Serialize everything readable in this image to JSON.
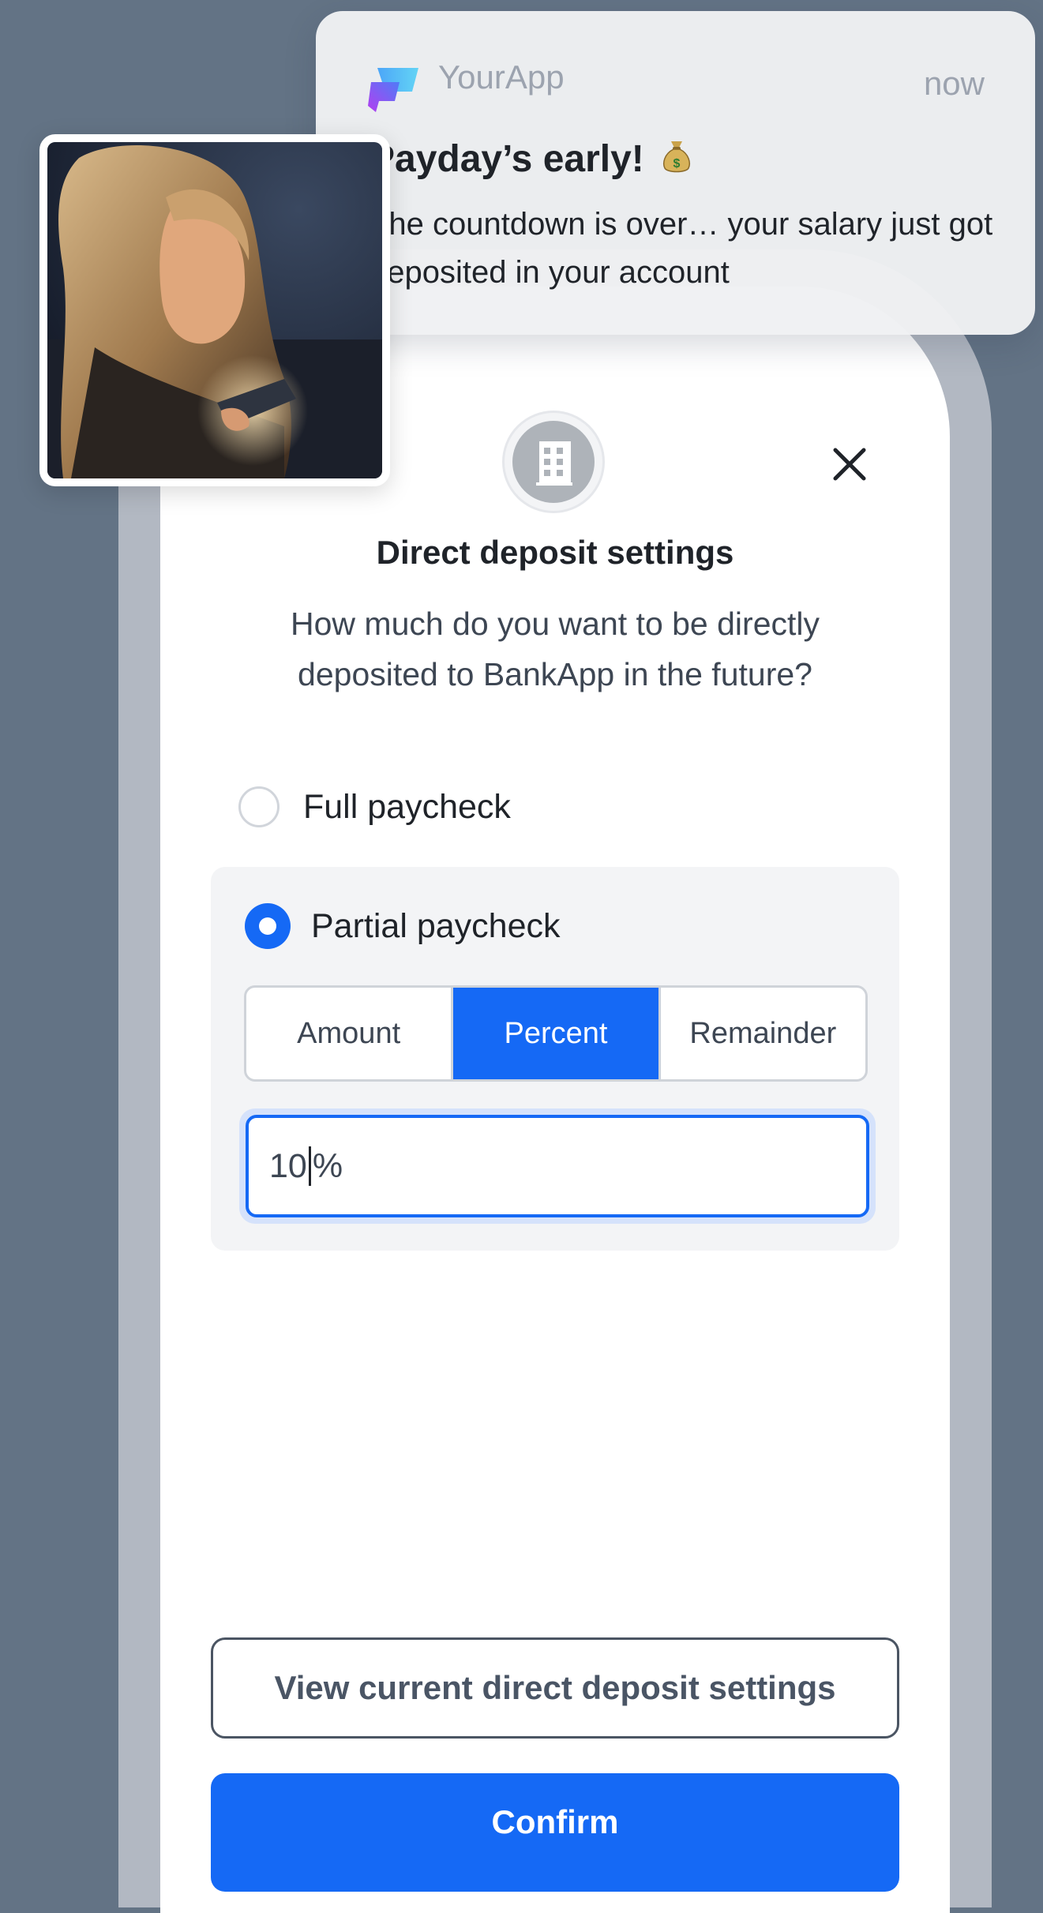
{
  "notification": {
    "app_name": "YourApp",
    "time": "now",
    "title": "Payday’s early!",
    "title_icon": "money-bag-icon",
    "body": "The countdown is over… your salary just got deposited in your account"
  },
  "modal": {
    "header_icon": "building-icon",
    "title": "Direct deposit settings",
    "subtitle": "How much do you want to be directly deposited to BankApp in the future?",
    "options": {
      "full_label": "Full paycheck",
      "partial_label": "Partial paycheck",
      "selected": "Partial paycheck"
    },
    "segments": [
      "Amount",
      "Percent",
      "Remainder"
    ],
    "active_segment": "Percent",
    "input": {
      "value": "10",
      "suffix": "%"
    },
    "view_settings_label": "View current direct deposit settings",
    "confirm_label": "Confirm"
  },
  "colors": {
    "background": "#637385",
    "accent": "#1569f5",
    "frame": "#b2b8c2"
  }
}
